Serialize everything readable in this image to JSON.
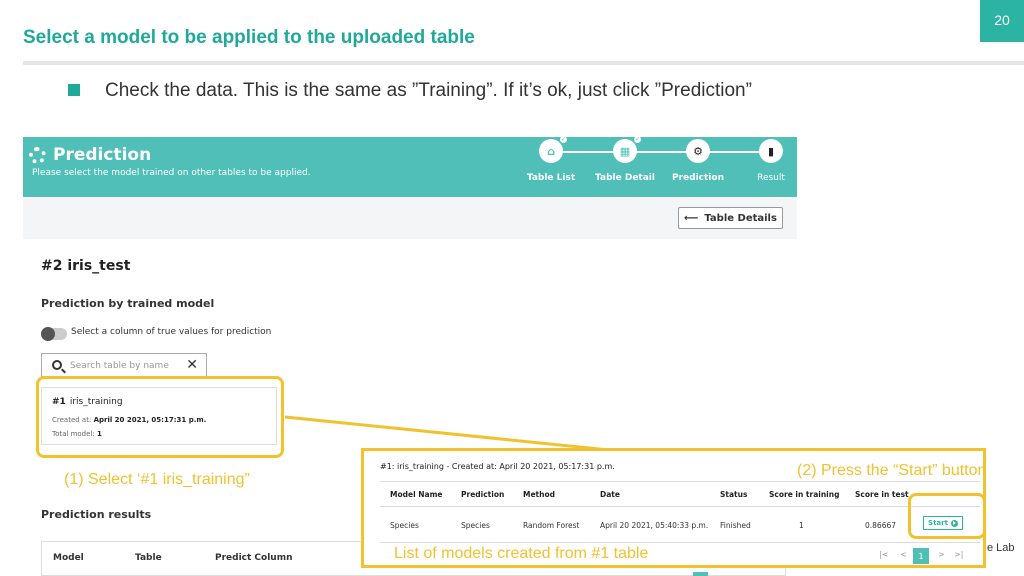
{
  "slide": {
    "title": "Select a model to be applied to the uploaded table",
    "page_number": "20",
    "bullet": "Check the data. This is the same as ”Training”. If it’s ok, just click ”Prediction”",
    "brand_fragment": "e Lab",
    "accent_color": "#1fa99a",
    "annotation_color": "#f2c12e"
  },
  "app": {
    "title": "Prediction",
    "subtitle": "Please select the model trained on other tables to be applied.",
    "steps": [
      {
        "label": "Table List",
        "icon": "home-icon"
      },
      {
        "label": "Table Detail",
        "icon": "table-icon"
      },
      {
        "label": "Prediction",
        "icon": "gear-icon"
      },
      {
        "label": "Result",
        "icon": "bar-chart-icon"
      }
    ],
    "table_details_button": "Table Details",
    "table_heading": "#2 iris_test",
    "prediction_by_model_label": "Prediction by trained model",
    "toggle_label": "Select a column of true values for prediction",
    "search_placeholder": "Search table by name",
    "model_card": {
      "number": "#1",
      "name": "iris_training",
      "created_label": "Created at:",
      "created_value": "April 20 2021, 05:17:31 p.m.",
      "total_label": "Total model:",
      "total_value": "1"
    },
    "prediction_results_label": "Prediction results",
    "results_columns": [
      "Model",
      "Table",
      "Predict Column"
    ]
  },
  "overlay": {
    "caption": "#1: iris_training - Created at: April 20 2021, 05:17:31 p.m.",
    "columns": [
      "Model Name",
      "Prediction",
      "Method",
      "Date",
      "Status",
      "Score in training",
      "Score in test"
    ],
    "rows": [
      [
        "Species",
        "Species",
        "Random Forest",
        "April 20 2021, 05:40:33 p.m.",
        "Finished",
        "1",
        "0.86667"
      ]
    ],
    "start_button": "Start",
    "pager": {
      "first": "|<",
      "prev": "<",
      "current": "1",
      "next": ">",
      "last": ">|"
    }
  },
  "annotations": {
    "select_label": "(1) Select ‘#1 iris_training”",
    "start_label": "(2) Press the “Start” button",
    "list_label": "List of models created from #1 table"
  }
}
